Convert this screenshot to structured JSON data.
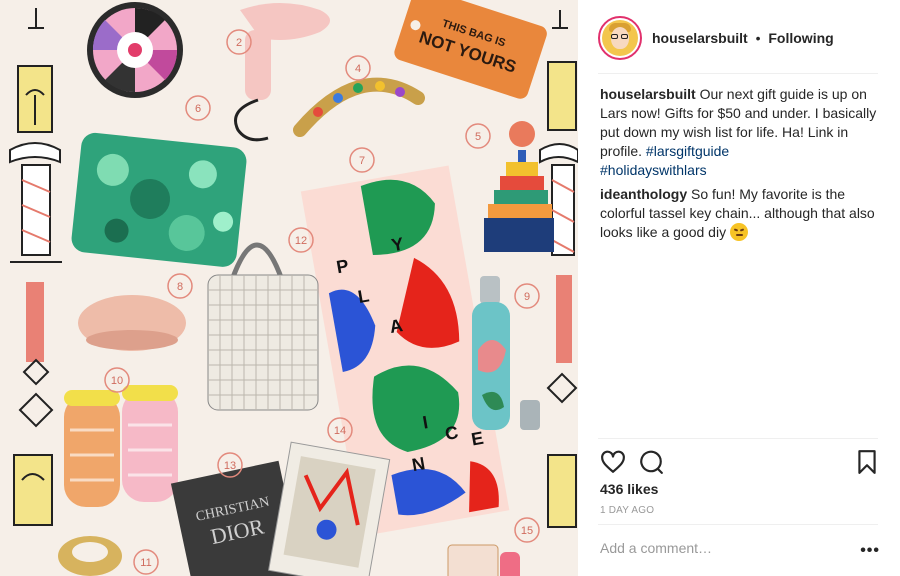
{
  "post": {
    "username": "houselarsbuilt",
    "separator": "•",
    "follow_status": "Following",
    "image": {
      "tag_text_line1": "THIS BAG IS",
      "tag_text_line2": "NOT YOURS",
      "book_line1": "CHRISTIAN",
      "book_line2": "DIOR",
      "number_labels": [
        "2",
        "4",
        "5",
        "6",
        "7",
        "8",
        "9",
        "10",
        "11",
        "12",
        "13",
        "14",
        "15"
      ],
      "play_nice_letters": [
        "P",
        "L",
        "A",
        "Y",
        "N",
        "I",
        "C",
        "E"
      ]
    },
    "comments": [
      {
        "user": "houselarsbuilt",
        "text": "Our next gift guide is up on Lars now! Gifts for $50 and under. I basically put down my wish list for life. Ha! Link in profile.",
        "hashtags": [
          "#larsgiftguide",
          "#holidayswithlars"
        ]
      },
      {
        "user": "ideanthology",
        "text": "So fun! My favorite is the colorful tassel key chain... although that also looks like a good diy"
      }
    ],
    "likes": "436 likes",
    "timestamp": "1 DAY AGO",
    "add_comment_placeholder": "Add a comment…",
    "more_label": "•••",
    "icons": [
      "heart-icon",
      "comment-icon",
      "bookmark-icon",
      "more-icon",
      "smirk-emoji-icon"
    ],
    "colors": {
      "text": "#262626",
      "hashtag": "#003569",
      "muted": "#999999",
      "divider": "#efefef",
      "image_bg": "#f6efe8"
    }
  }
}
